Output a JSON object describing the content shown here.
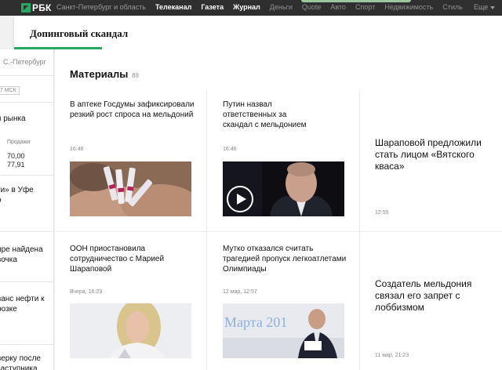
{
  "topnav": {
    "logo": "РБК",
    "region": "Санкт-Петербург и область",
    "links": [
      {
        "label": "Телеканал",
        "strong": true
      },
      {
        "label": "Газета",
        "strong": true
      },
      {
        "label": "Журнал",
        "strong": true
      },
      {
        "label": "Деньги",
        "strong": false
      },
      {
        "label": "Quote",
        "strong": false
      },
      {
        "label": "Авто",
        "strong": false
      },
      {
        "label": "Спорт",
        "strong": false
      },
      {
        "label": "Недвижимость",
        "strong": false
      },
      {
        "label": "Стиль",
        "strong": false
      }
    ],
    "more": "Еще"
  },
  "page": {
    "title": "Допинговый скандал"
  },
  "sidebar": {
    "city": "С.-Петербург",
    "time_badge": "07 МСК",
    "market_title": "я рынка",
    "sell_label": "Продажи",
    "values": [
      "70,00",
      "77,91"
    ],
    "news": [
      {
        "line1": "ти» в Уфе",
        "line2": "о"
      },
      {
        "line1": "ире найдена",
        "line2": "вочка"
      },
      {
        "line1": "ванс нефти к",
        "line2": "розке"
      },
      {
        "line1": "верку после",
        "line2": "заступника"
      }
    ]
  },
  "materials": {
    "title": "Материалы",
    "count": "88",
    "cards": [
      {
        "title": "В аптеке Госдумы зафиксировали резкий рост спроса на мельдоний",
        "time": "16:46"
      },
      {
        "title": "Путин назвал ответственных за скандал с мельдонием",
        "time": "16:46"
      },
      {
        "title": "Шараповой предложили стать лицом «Вятского кваса»",
        "time": "12:55"
      },
      {
        "title": "ООН приостановила сотрудничество с Марией Шараповой",
        "time": "Вчера, 16:23"
      },
      {
        "title": "Мутко отказался считать трагедией пропуск легкоатлетами Олимпиады",
        "time": "12 мар, 12:57"
      },
      {
        "title": "Создатель мельдония связал его запрет с лоббизмом",
        "time": "11 мар, 21:23"
      }
    ],
    "thumb4_text": "Марта 201"
  },
  "icons": {
    "logo": "rbc-logo-icon",
    "more": "chevron-down-icon",
    "video": "play-icon"
  },
  "colors": {
    "accent": "#27a860",
    "topbar": "#2f2f2f"
  }
}
